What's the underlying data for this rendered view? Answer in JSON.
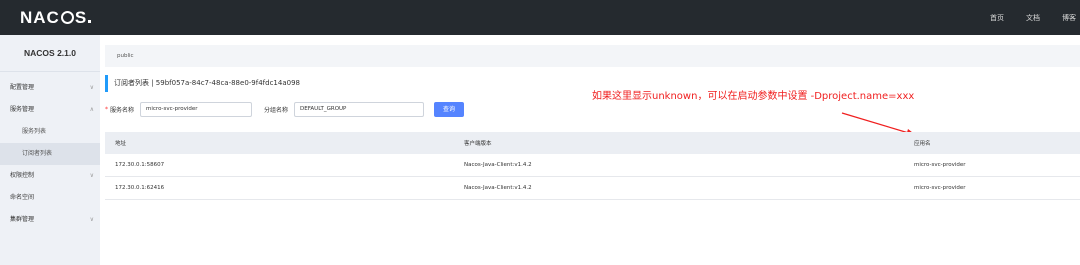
{
  "header": {
    "logo_text": "NACOS.",
    "nav": [
      "首页",
      "文档",
      "博客"
    ]
  },
  "sidebar": {
    "title": "NACOS 2.1.0",
    "items": [
      {
        "label": "配置管理",
        "chevron": "chevron-down"
      },
      {
        "label": "服务管理",
        "chevron": "chevron-up"
      },
      {
        "label": "服务列表",
        "sub": true
      },
      {
        "label": "订阅者列表",
        "sub": true,
        "active": true
      },
      {
        "label": "权限控制",
        "chevron": "chevron-down"
      },
      {
        "label": "命名空间"
      },
      {
        "label": "集群管理",
        "chevron": "chevron-down"
      }
    ]
  },
  "main": {
    "namespace": "public",
    "page_title": "订阅者列表  |   59bf057a-84c7-48ca-88e0-9f4fdc14a098",
    "form": {
      "service_label": "服务名称",
      "service_value": "micro-svc-provider",
      "group_label": "分组名称",
      "group_value": "DEFAULT_GROUP",
      "query_button": "查询"
    },
    "annotation": "如果这里显示unknown，可以在启动参数中设置 -Dproject.name=xxx",
    "table": {
      "headers": [
        "地址",
        "客户端版本",
        "应用名"
      ],
      "rows": [
        [
          "172.30.0.1:58607",
          "Nacos-Java-Client:v1.4.2",
          "micro-svc-provider"
        ],
        [
          "172.30.0.1:62416",
          "Nacos-Java-Client:v1.4.2",
          "micro-svc-provider"
        ]
      ]
    }
  },
  "colors": {
    "topbar": "#252a2f",
    "sidebar": "#eef1f6",
    "accent": "#209bfa",
    "button": "#5584ff",
    "annotation": "#f01f1f"
  }
}
